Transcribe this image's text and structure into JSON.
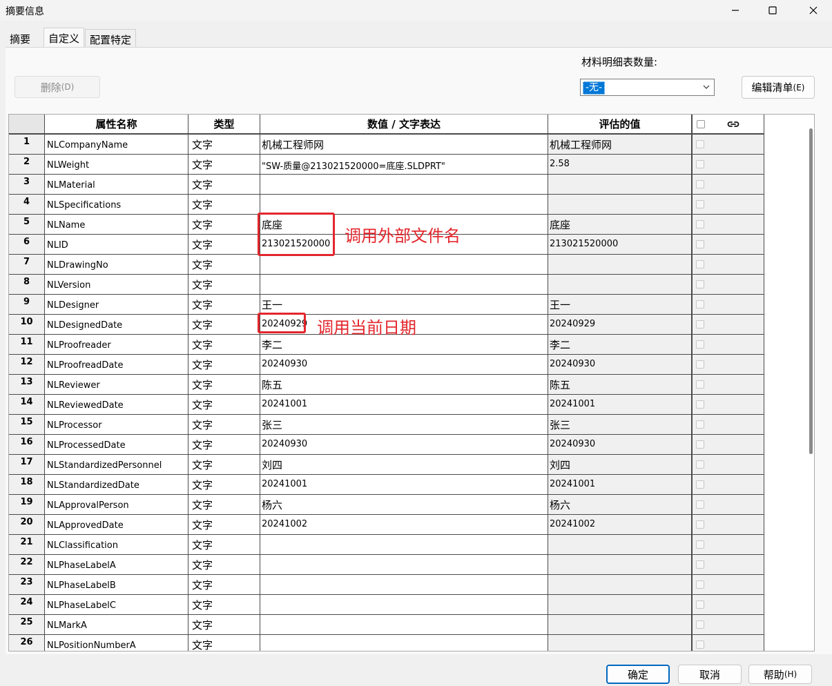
{
  "window": {
    "title": "摘要信息"
  },
  "tabs": [
    {
      "label": "摘要"
    },
    {
      "label": "自定义"
    },
    {
      "label": "配置特定"
    }
  ],
  "toolbar": {
    "delete_label": "删除",
    "delete_mnemonic": "(D)",
    "bom_label": "材料明细表数量:",
    "bom_selected": "-无-",
    "edit_list_label": "编辑清单",
    "edit_list_mnemonic": "(E)"
  },
  "table": {
    "headers": [
      "",
      "属性名称",
      "类型",
      "数值 / 文字表达",
      "评估的值",
      ""
    ],
    "rows": [
      {
        "num": "1",
        "name": "NLCompanyName",
        "type": "文字",
        "value": "机械工程师网",
        "evaluated": "机械工程师网"
      },
      {
        "num": "2",
        "name": "NLWeight",
        "type": "文字",
        "value": "\"SW-质量@213021520000=底座.SLDPRT\"",
        "evaluated": "2.58"
      },
      {
        "num": "3",
        "name": "NLMaterial",
        "type": "文字",
        "value": "",
        "evaluated": ""
      },
      {
        "num": "4",
        "name": "NLSpecifications",
        "type": "文字",
        "value": "",
        "evaluated": ""
      },
      {
        "num": "5",
        "name": "NLName",
        "type": "文字",
        "value": "底座",
        "evaluated": "底座"
      },
      {
        "num": "6",
        "name": "NLID",
        "type": "文字",
        "value": "213021520000",
        "evaluated": "213021520000"
      },
      {
        "num": "7",
        "name": "NLDrawingNo",
        "type": "文字",
        "value": "",
        "evaluated": ""
      },
      {
        "num": "8",
        "name": "NLVersion",
        "type": "文字",
        "value": "",
        "evaluated": ""
      },
      {
        "num": "9",
        "name": "NLDesigner",
        "type": "文字",
        "value": "王一",
        "evaluated": "王一"
      },
      {
        "num": "10",
        "name": "NLDesignedDate",
        "type": "文字",
        "value": "20240929",
        "evaluated": "20240929"
      },
      {
        "num": "11",
        "name": "NLProofreader",
        "type": "文字",
        "value": "李二",
        "evaluated": "李二"
      },
      {
        "num": "12",
        "name": "NLProofreadDate",
        "type": "文字",
        "value": "20240930",
        "evaluated": "20240930"
      },
      {
        "num": "13",
        "name": "NLReviewer",
        "type": "文字",
        "value": "陈五",
        "evaluated": "陈五"
      },
      {
        "num": "14",
        "name": "NLReviewedDate",
        "type": "文字",
        "value": "20241001",
        "evaluated": "20241001"
      },
      {
        "num": "15",
        "name": "NLProcessor",
        "type": "文字",
        "value": "张三",
        "evaluated": "张三"
      },
      {
        "num": "16",
        "name": "NLProcessedDate",
        "type": "文字",
        "value": "20240930",
        "evaluated": "20240930"
      },
      {
        "num": "17",
        "name": "NLStandardizedPersonnel",
        "type": "文字",
        "value": "刘四",
        "evaluated": "刘四"
      },
      {
        "num": "18",
        "name": "NLStandardizedDate",
        "type": "文字",
        "value": "20241001",
        "evaluated": "20241001"
      },
      {
        "num": "19",
        "name": "NLApprovalPerson",
        "type": "文字",
        "value": "杨六",
        "evaluated": "杨六"
      },
      {
        "num": "20",
        "name": "NLApprovedDate",
        "type": "文字",
        "value": "20241002",
        "evaluated": "20241002"
      },
      {
        "num": "21",
        "name": "NLClassification",
        "type": "文字",
        "value": "",
        "evaluated": ""
      },
      {
        "num": "22",
        "name": "NLPhaseLabelA",
        "type": "文字",
        "value": "",
        "evaluated": ""
      },
      {
        "num": "23",
        "name": "NLPhaseLabelB",
        "type": "文字",
        "value": "",
        "evaluated": ""
      },
      {
        "num": "24",
        "name": "NLPhaseLabelC",
        "type": "文字",
        "value": "",
        "evaluated": ""
      },
      {
        "num": "25",
        "name": "NLMarkA",
        "type": "文字",
        "value": "",
        "evaluated": ""
      },
      {
        "num": "26",
        "name": "NLPositionNumberA",
        "type": "文字",
        "value": "",
        "evaluated": ""
      }
    ]
  },
  "annotations": {
    "external_filename": "调用外部文件名",
    "current_date": "调用当前日期"
  },
  "footer": {
    "ok_label": "确定",
    "cancel_label": "取消",
    "help_label": "帮助",
    "help_mnemonic": "(H)"
  },
  "colors": {
    "annotation": "#e3262c",
    "selection": "#0078d7",
    "default_button_border": "#0067c0"
  },
  "icons": {
    "minimize": "minimize-icon",
    "maximize": "maximize-icon",
    "close": "close-icon",
    "dropdown": "chevron-down-icon",
    "link": "link-icon"
  }
}
